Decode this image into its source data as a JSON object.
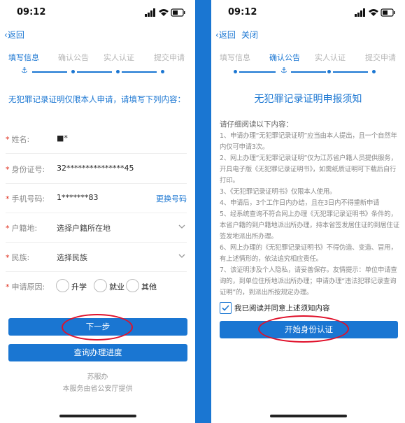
{
  "left": {
    "status_time": "09:12",
    "back_label": "返回",
    "steps": [
      "填写信息",
      "确认公告",
      "实人认证",
      "提交申请"
    ],
    "notice": "无犯罪记录证明仅限本人申请，请填写下列内容：",
    "fields": {
      "name": {
        "label": "姓名:",
        "value": "■*"
      },
      "id": {
        "label": "身份证号:",
        "value": "32***************45"
      },
      "phone": {
        "label": "手机号码:",
        "value": "1*******83",
        "action": "更换号码"
      },
      "hukou": {
        "label": "户籍地:",
        "placeholder": "选择户籍所在地"
      },
      "ethnicity": {
        "label": "民族:",
        "placeholder": "选择民族"
      },
      "reason": {
        "label": "申请原因:",
        "options": [
          "升学",
          "就业",
          "其他"
        ]
      }
    },
    "next_button": "下一步",
    "query_button": "查询办理进度",
    "footer_app": "苏服办",
    "footer_provider": "本服务由省公安厅提供"
  },
  "right": {
    "status_time": "09:12",
    "back_label": "返回",
    "close_label": "关闭",
    "steps": [
      "填写信息",
      "确认公告",
      "实人认证",
      "提交申请"
    ],
    "title": "无犯罪记录证明申报须知",
    "read_hint": "请仔细阅读以下内容：",
    "rules": [
      "1、申请办理“无犯罪记录证明”应当由本人提出，且一个自然年内仅可申请3次。",
      "2、网上办理“无犯罪记录证明”仅为江苏省户籍人员提供服务，开具电子版《无犯罪记录证明书》，如需纸质证明可下载后自行打印。",
      "3、《无犯罪记录证明书》仅限本人使用。",
      "4、申请后，3个工作日内办结，且在3日内不得重新申请",
      "5、经系统查询不符合网上办理《无犯罪记录证明书》条件的，本省户籍的到户籍地派出所办理，持本省签发居住证的到居住证签发地派出所办理。",
      "6、网上办理的《无犯罪记录证明书》不得伪造、变造、冒用，有上述情形的，依法追究相应责任。",
      "7、该证明涉及个人隐私，请妥善保存。友情提示：单位申请查询的，到单位住所地派出所办理；申请办理“违法犯罪记录查询证明”的，到派出所按规定办理。"
    ],
    "agree_text": "我已阅读并同意上述须知内容",
    "start_button": "开始身份认证"
  },
  "colors": {
    "accent": "#1a76d2",
    "highlight": "#e0102a",
    "required": "#e0301e"
  }
}
